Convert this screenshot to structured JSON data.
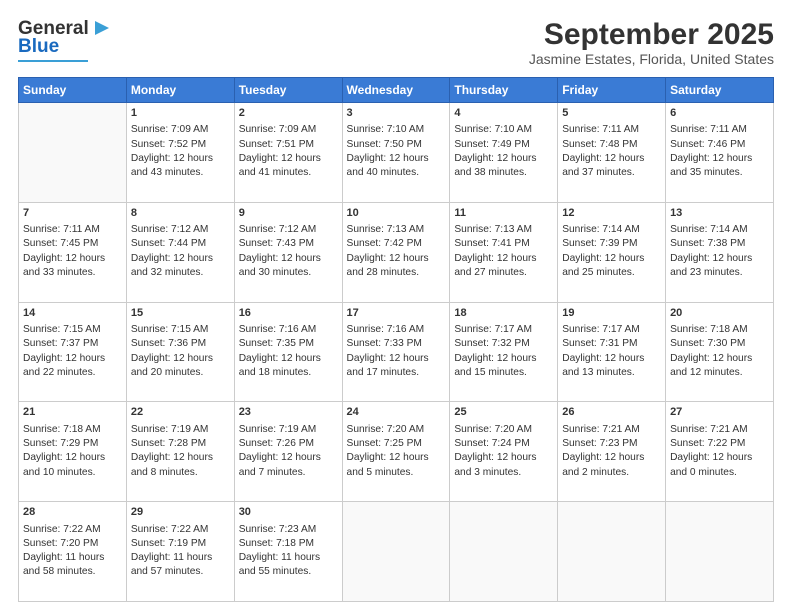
{
  "header": {
    "logo_line1": "General",
    "logo_line2": "Blue",
    "title": "September 2025",
    "subtitle": "Jasmine Estates, Florida, United States"
  },
  "days_of_week": [
    "Sunday",
    "Monday",
    "Tuesday",
    "Wednesday",
    "Thursday",
    "Friday",
    "Saturday"
  ],
  "weeks": [
    [
      {
        "day": "",
        "data": ""
      },
      {
        "day": "1",
        "data": "Sunrise: 7:09 AM\nSunset: 7:52 PM\nDaylight: 12 hours and 43 minutes."
      },
      {
        "day": "2",
        "data": "Sunrise: 7:09 AM\nSunset: 7:51 PM\nDaylight: 12 hours and 41 minutes."
      },
      {
        "day": "3",
        "data": "Sunrise: 7:10 AM\nSunset: 7:50 PM\nDaylight: 12 hours and 40 minutes."
      },
      {
        "day": "4",
        "data": "Sunrise: 7:10 AM\nSunset: 7:49 PM\nDaylight: 12 hours and 38 minutes."
      },
      {
        "day": "5",
        "data": "Sunrise: 7:11 AM\nSunset: 7:48 PM\nDaylight: 12 hours and 37 minutes."
      },
      {
        "day": "6",
        "data": "Sunrise: 7:11 AM\nSunset: 7:46 PM\nDaylight: 12 hours and 35 minutes."
      }
    ],
    [
      {
        "day": "7",
        "data": "Sunrise: 7:11 AM\nSunset: 7:45 PM\nDaylight: 12 hours and 33 minutes."
      },
      {
        "day": "8",
        "data": "Sunrise: 7:12 AM\nSunset: 7:44 PM\nDaylight: 12 hours and 32 minutes."
      },
      {
        "day": "9",
        "data": "Sunrise: 7:12 AM\nSunset: 7:43 PM\nDaylight: 12 hours and 30 minutes."
      },
      {
        "day": "10",
        "data": "Sunrise: 7:13 AM\nSunset: 7:42 PM\nDaylight: 12 hours and 28 minutes."
      },
      {
        "day": "11",
        "data": "Sunrise: 7:13 AM\nSunset: 7:41 PM\nDaylight: 12 hours and 27 minutes."
      },
      {
        "day": "12",
        "data": "Sunrise: 7:14 AM\nSunset: 7:39 PM\nDaylight: 12 hours and 25 minutes."
      },
      {
        "day": "13",
        "data": "Sunrise: 7:14 AM\nSunset: 7:38 PM\nDaylight: 12 hours and 23 minutes."
      }
    ],
    [
      {
        "day": "14",
        "data": "Sunrise: 7:15 AM\nSunset: 7:37 PM\nDaylight: 12 hours and 22 minutes."
      },
      {
        "day": "15",
        "data": "Sunrise: 7:15 AM\nSunset: 7:36 PM\nDaylight: 12 hours and 20 minutes."
      },
      {
        "day": "16",
        "data": "Sunrise: 7:16 AM\nSunset: 7:35 PM\nDaylight: 12 hours and 18 minutes."
      },
      {
        "day": "17",
        "data": "Sunrise: 7:16 AM\nSunset: 7:33 PM\nDaylight: 12 hours and 17 minutes."
      },
      {
        "day": "18",
        "data": "Sunrise: 7:17 AM\nSunset: 7:32 PM\nDaylight: 12 hours and 15 minutes."
      },
      {
        "day": "19",
        "data": "Sunrise: 7:17 AM\nSunset: 7:31 PM\nDaylight: 12 hours and 13 minutes."
      },
      {
        "day": "20",
        "data": "Sunrise: 7:18 AM\nSunset: 7:30 PM\nDaylight: 12 hours and 12 minutes."
      }
    ],
    [
      {
        "day": "21",
        "data": "Sunrise: 7:18 AM\nSunset: 7:29 PM\nDaylight: 12 hours and 10 minutes."
      },
      {
        "day": "22",
        "data": "Sunrise: 7:19 AM\nSunset: 7:28 PM\nDaylight: 12 hours and 8 minutes."
      },
      {
        "day": "23",
        "data": "Sunrise: 7:19 AM\nSunset: 7:26 PM\nDaylight: 12 hours and 7 minutes."
      },
      {
        "day": "24",
        "data": "Sunrise: 7:20 AM\nSunset: 7:25 PM\nDaylight: 12 hours and 5 minutes."
      },
      {
        "day": "25",
        "data": "Sunrise: 7:20 AM\nSunset: 7:24 PM\nDaylight: 12 hours and 3 minutes."
      },
      {
        "day": "26",
        "data": "Sunrise: 7:21 AM\nSunset: 7:23 PM\nDaylight: 12 hours and 2 minutes."
      },
      {
        "day": "27",
        "data": "Sunrise: 7:21 AM\nSunset: 7:22 PM\nDaylight: 12 hours and 0 minutes."
      }
    ],
    [
      {
        "day": "28",
        "data": "Sunrise: 7:22 AM\nSunset: 7:20 PM\nDaylight: 11 hours and 58 minutes."
      },
      {
        "day": "29",
        "data": "Sunrise: 7:22 AM\nSunset: 7:19 PM\nDaylight: 11 hours and 57 minutes."
      },
      {
        "day": "30",
        "data": "Sunrise: 7:23 AM\nSunset: 7:18 PM\nDaylight: 11 hours and 55 minutes."
      },
      {
        "day": "",
        "data": ""
      },
      {
        "day": "",
        "data": ""
      },
      {
        "day": "",
        "data": ""
      },
      {
        "day": "",
        "data": ""
      }
    ]
  ]
}
